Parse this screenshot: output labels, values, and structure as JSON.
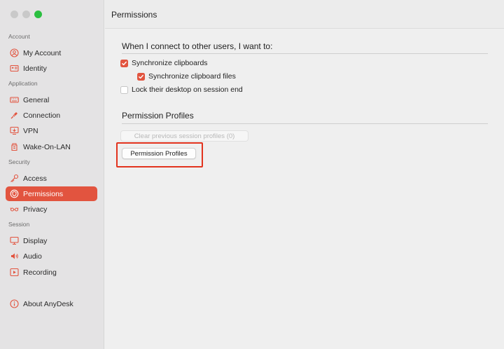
{
  "window": {
    "title": "Permissions"
  },
  "colors": {
    "accent": "#e2543f",
    "highlight": "#e2331e"
  },
  "sidebar": {
    "sections": {
      "account": "Account",
      "application": "Application",
      "security": "Security",
      "session": "Session"
    },
    "items": [
      {
        "label": "My Account",
        "icon": "user-circle-icon"
      },
      {
        "label": "Identity",
        "icon": "id-card-icon"
      },
      {
        "label": "General",
        "icon": "keyboard-icon"
      },
      {
        "label": "Connection",
        "icon": "plug-icon"
      },
      {
        "label": "VPN",
        "icon": "vpn-screen-icon"
      },
      {
        "label": "Wake-On-LAN",
        "icon": "wake-on-lan-icon"
      },
      {
        "label": "Access",
        "icon": "key-icon"
      },
      {
        "label": "Permissions",
        "icon": "shield-icon",
        "active": true
      },
      {
        "label": "Privacy",
        "icon": "glasses-icon"
      },
      {
        "label": "Display",
        "icon": "monitor-icon"
      },
      {
        "label": "Audio",
        "icon": "speaker-icon"
      },
      {
        "label": "Recording",
        "icon": "play-icon"
      },
      {
        "label": "About AnyDesk",
        "icon": "info-icon"
      }
    ]
  },
  "main": {
    "connect_heading": "When I connect to other users, I want to:",
    "options": [
      {
        "label": "Synchronize clipboards",
        "checked": true
      },
      {
        "label": "Synchronize clipboard files",
        "checked": true
      },
      {
        "label": "Lock their desktop on session end",
        "checked": false
      }
    ],
    "profiles_heading": "Permission Profiles",
    "clear_button": "Clear previous session profiles (0)",
    "profiles_button": "Permission Profiles"
  }
}
